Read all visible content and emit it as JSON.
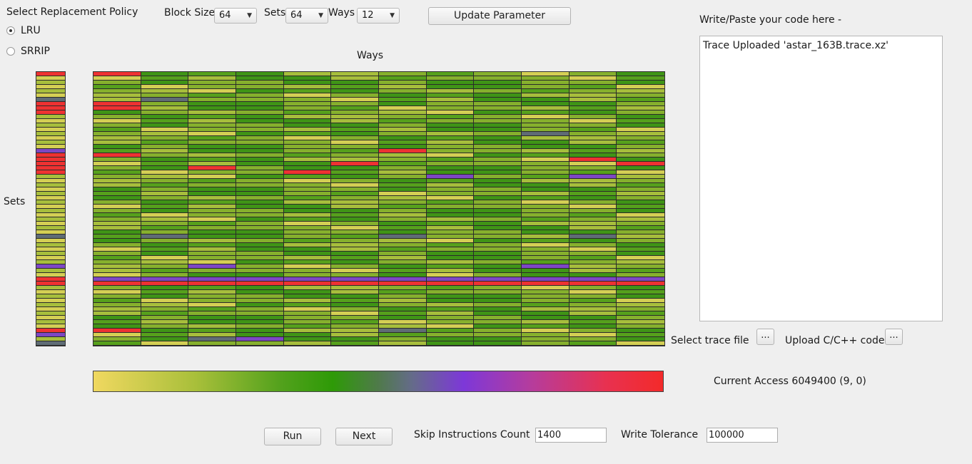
{
  "policy": {
    "title": "Select Replacement Policy",
    "options": [
      {
        "label": "LRU",
        "selected": true
      },
      {
        "label": "SRRIP",
        "selected": false
      }
    ]
  },
  "params": {
    "block_size_label": "Block Size",
    "block_size_value": "64",
    "sets_label": "Sets",
    "sets_value": "64",
    "ways_label": "Ways",
    "ways_value": "12",
    "update_button": "Update Parameter"
  },
  "heatmap": {
    "ways_label": "Ways",
    "sets_label": "Sets",
    "ways_count": 12,
    "sets_count": 64,
    "palette": {
      "lightYellow": "#d4cf54",
      "yellowGreen": "#a7be3c",
      "oliveGreen": "#86b02d",
      "green": "#56a01c",
      "darkGreen": "#3f9416",
      "grayBlue": "#5f6c75",
      "purple": "#7d47c4",
      "red": "#ee3232"
    },
    "hot_cells": [
      {
        "set": 0,
        "way": 0,
        "state": "red"
      },
      {
        "set": 7,
        "way": 0,
        "state": "red"
      },
      {
        "set": 8,
        "way": 0,
        "state": "red"
      },
      {
        "set": 19,
        "way": 0,
        "state": "red"
      },
      {
        "set": 18,
        "way": 6,
        "state": "red"
      },
      {
        "set": 20,
        "way": 10,
        "state": "red"
      },
      {
        "set": 21,
        "way": 5,
        "state": "red"
      },
      {
        "set": 21,
        "way": 11,
        "state": "red"
      },
      {
        "set": 22,
        "way": 2,
        "state": "red"
      },
      {
        "set": 23,
        "way": 4,
        "state": "red"
      },
      {
        "set": 24,
        "way": 7,
        "state": "purple"
      },
      {
        "set": 24,
        "way": 10,
        "state": "purple"
      },
      {
        "set": 6,
        "way": 1,
        "state": "grayBlue"
      },
      {
        "set": 14,
        "way": 9,
        "state": "grayBlue"
      },
      {
        "set": 38,
        "way": 1,
        "state": "grayBlue"
      },
      {
        "set": 38,
        "way": 6,
        "state": "grayBlue"
      },
      {
        "set": 38,
        "way": 10,
        "state": "grayBlue"
      },
      {
        "set": 45,
        "way": 2,
        "state": "purple"
      },
      {
        "set": 45,
        "way": 9,
        "state": "purple"
      },
      {
        "set": 47,
        "way": 0,
        "state": "lightYellow"
      },
      {
        "set": 47,
        "way": 7,
        "state": "lightYellow"
      },
      {
        "set": 60,
        "way": 0,
        "state": "red"
      },
      {
        "set": 60,
        "way": 6,
        "state": "grayBlue"
      },
      {
        "set": 62,
        "way": 3,
        "state": "purple"
      },
      {
        "set": 62,
        "way": 2,
        "state": "grayBlue"
      }
    ],
    "full_rows": [
      {
        "set": 48,
        "state": "purple"
      },
      {
        "set": 49,
        "state": "red"
      }
    ],
    "set_column_hot": [
      {
        "set": 0,
        "state": "red"
      },
      {
        "set": 6,
        "state": "grayBlue"
      },
      {
        "set": 7,
        "state": "red"
      },
      {
        "set": 8,
        "state": "red"
      },
      {
        "set": 9,
        "state": "red"
      },
      {
        "set": 18,
        "state": "purple"
      },
      {
        "set": 19,
        "state": "red"
      },
      {
        "set": 20,
        "state": "red"
      },
      {
        "set": 21,
        "state": "red"
      },
      {
        "set": 22,
        "state": "red"
      },
      {
        "set": 23,
        "state": "red"
      },
      {
        "set": 38,
        "state": "grayBlue"
      },
      {
        "set": 45,
        "state": "purple"
      },
      {
        "set": 48,
        "state": "red"
      },
      {
        "set": 49,
        "state": "red"
      },
      {
        "set": 60,
        "state": "red"
      },
      {
        "set": 61,
        "state": "purple"
      },
      {
        "set": 63,
        "state": "grayBlue"
      }
    ]
  },
  "colorbar": {
    "colors": [
      "#f0d860",
      "#2e9a07",
      "#7d38d8",
      "#f32a2a"
    ]
  },
  "code_panel": {
    "label": "Write/Paste your code here -",
    "content": "Trace Uploaded 'astar_163B.trace.xz'"
  },
  "files": {
    "trace_label": "Select trace file",
    "trace_button": "...",
    "upload_label": "Upload C/C++ code",
    "upload_button": "..."
  },
  "status": {
    "current_access": "Current Access 6049400 (9, 0)"
  },
  "controls": {
    "run": "Run",
    "next": "Next",
    "skip_label": "Skip Instructions Count",
    "skip_value": "1400",
    "tolerance_label": "Write Tolerance",
    "tolerance_value": "100000"
  }
}
